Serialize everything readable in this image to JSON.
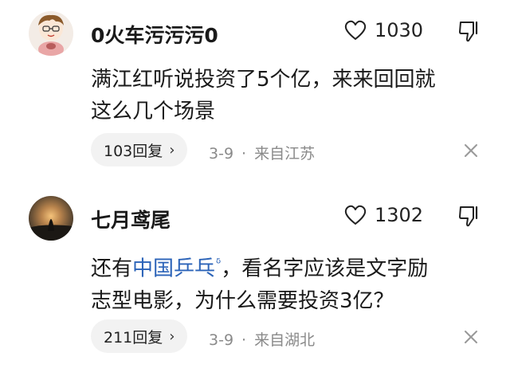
{
  "comments": [
    {
      "username": "0火车污污污0",
      "like_count": "1030",
      "body_line1": "满江红听说投资了5个亿，来来回回就",
      "body_line2": "这么几个场景",
      "replies_label": "103回复",
      "date": "3-9",
      "location": "来自江苏"
    },
    {
      "username": "七月鸢尾",
      "like_count": "1302",
      "body_pre": "还有",
      "body_link": "中国乒乓",
      "body_post": "，看名字应该是文字励",
      "body_line2": "志型电影，为什么需要投资3亿？",
      "replies_label": "211回复",
      "date": "3-9",
      "location": "来自湖北"
    }
  ],
  "separator": "·",
  "chevron": "›",
  "icons": {
    "like": "heart-outline-icon",
    "dislike": "thumbs-down-icon",
    "close": "close-icon",
    "link_mark": "search-link-icon"
  },
  "colors": {
    "link": "#2b63b8",
    "meta": "#8a8a8a",
    "pill_bg": "#f2f2f2"
  }
}
